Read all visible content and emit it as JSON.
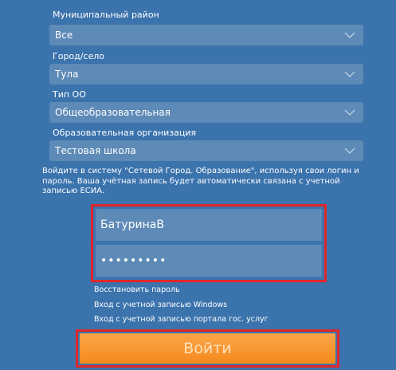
{
  "form": {
    "fields": [
      {
        "label": "Муниципальный район",
        "value": "Все"
      },
      {
        "label": "Город/село",
        "value": "Тула"
      },
      {
        "label": "Тип ОО",
        "value": "Общеобразовательная"
      },
      {
        "label": "Образовательная организация",
        "value": "Тестовая школа"
      }
    ],
    "info_text": "Войдите в систему \"Сетевой Город. Образование\", используя свои логин и пароль. Ваша учётная запись будет автоматически связана с учетной записью ЕСИА.",
    "username_value": "БатуринаВ",
    "password_mask": "•••••••••",
    "links": {
      "restore_password": "Восстановить пароль",
      "windows_login": "Вход с учетной записью Windows",
      "gosuslugi_login": "Вход с учетной записью портала гос. услуг"
    },
    "login_button": "Войти"
  },
  "colors": {
    "background": "#3b73ad",
    "field": "#5d8ab6",
    "highlight": "#e0262a",
    "button": "#f48a1c"
  }
}
